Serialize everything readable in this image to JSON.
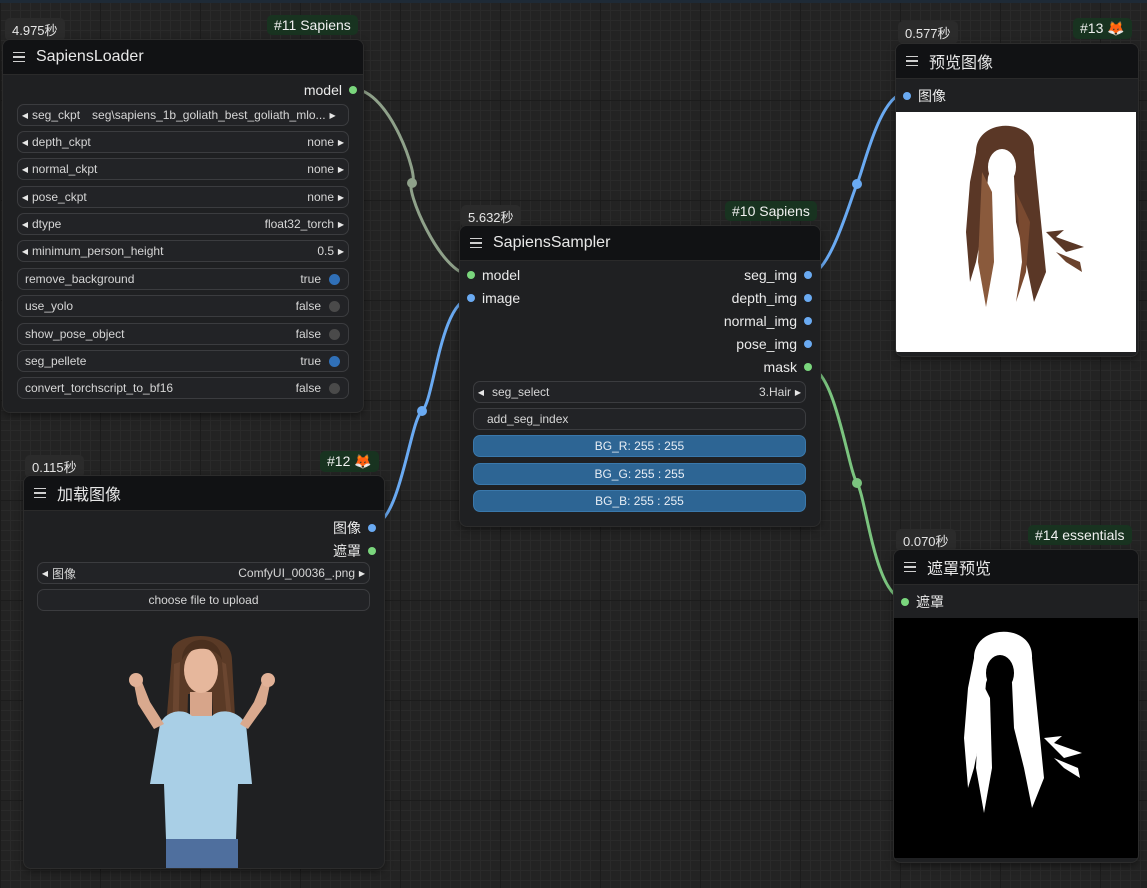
{
  "canvas": {
    "link_colors": {
      "model": "#8fa18a",
      "image": "#6aaaf2",
      "mask": "#7bc47f"
    }
  },
  "nodes": {
    "loader": {
      "timing": "4.975秒",
      "badge": "#11 Sapiens",
      "title": "SapiensLoader",
      "outputs": {
        "model": "model"
      },
      "widgets": {
        "seg_ckpt": {
          "label": "seg_ckpt",
          "value": "seg\\sapiens_1b_goliath_best_goliath_mlo..."
        },
        "depth_ckpt": {
          "label": "depth_ckpt",
          "value": "none"
        },
        "normal_ckpt": {
          "label": "normal_ckpt",
          "value": "none"
        },
        "pose_ckpt": {
          "label": "pose_ckpt",
          "value": "none"
        },
        "dtype": {
          "label": "dtype",
          "value": "float32_torch"
        },
        "minimum_person_height": {
          "label": "minimum_person_height",
          "value": "0.5"
        },
        "remove_background": {
          "label": "remove_background",
          "value": "true"
        },
        "use_yolo": {
          "label": "use_yolo",
          "value": "false"
        },
        "show_pose_object": {
          "label": "show_pose_object",
          "value": "false"
        },
        "seg_pellete": {
          "label": "seg_pellete",
          "value": "true"
        },
        "convert_torchscript_to_bf16": {
          "label": "convert_torchscript_to_bf16",
          "value": "false"
        }
      }
    },
    "load_image": {
      "timing": "0.115秒",
      "badge": "#12 🦊",
      "title": "加载图像",
      "outputs": {
        "image": "图像",
        "mask": "遮罩"
      },
      "widgets": {
        "image": {
          "label": "图像",
          "value": "ComfyUI_00036_.png"
        },
        "upload": {
          "label": "choose file to upload"
        }
      }
    },
    "sampler": {
      "timing": "5.632秒",
      "badge": "#10 Sapiens",
      "title": "SapiensSampler",
      "inputs": {
        "model": "model",
        "image": "image"
      },
      "outputs": {
        "seg_img": "seg_img",
        "depth_img": "depth_img",
        "normal_img": "normal_img",
        "pose_img": "pose_img",
        "mask": "mask"
      },
      "widgets": {
        "seg_select": {
          "label": "seg_select",
          "value": "3.Hair"
        },
        "add_seg_index": {
          "label": "add_seg_index"
        },
        "bg_r": {
          "text": "BG_R: 255 : 255"
        },
        "bg_g": {
          "text": "BG_G: 255 : 255"
        },
        "bg_b": {
          "text": "BG_B: 255 : 255"
        }
      }
    },
    "preview": {
      "timing": "0.577秒",
      "badge": "#13 🦊",
      "title": "预览图像",
      "inputs": {
        "image": "图像"
      }
    },
    "mask_preview": {
      "timing": "0.070秒",
      "badge": "#14 essentials",
      "title": "遮罩预览",
      "inputs": {
        "mask": "遮罩"
      }
    }
  }
}
